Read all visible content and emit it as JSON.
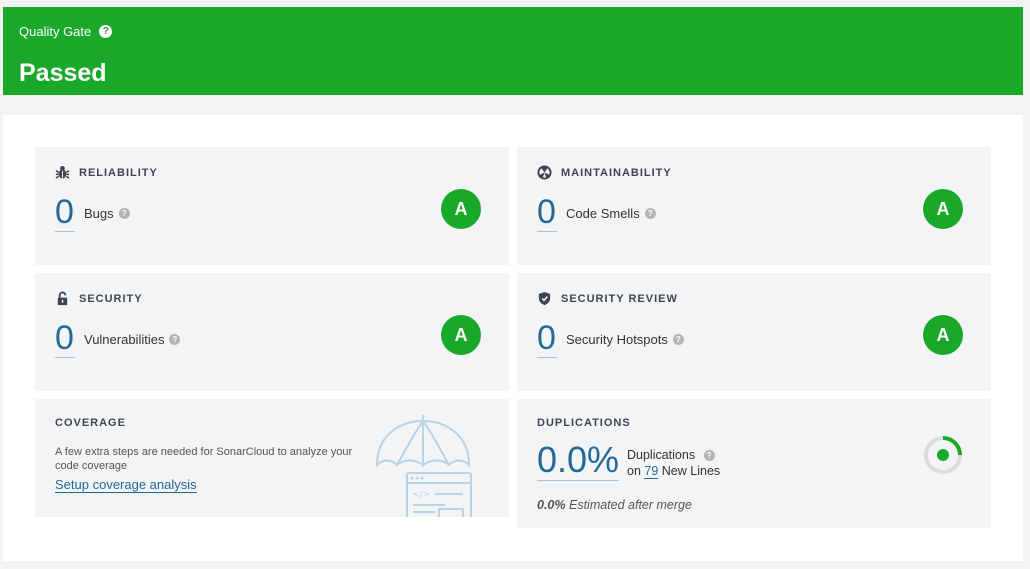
{
  "quality_gate": {
    "label": "Quality Gate",
    "help": "?",
    "status": "Passed",
    "color": "#1aa82b"
  },
  "cards": {
    "reliability": {
      "title": "RELIABILITY",
      "icon": "bug-icon",
      "value": "0",
      "label": "Bugs",
      "rating": "A"
    },
    "maintainability": {
      "title": "MAINTAINABILITY",
      "icon": "code-smell-icon",
      "value": "0",
      "label": "Code Smells",
      "rating": "A"
    },
    "security": {
      "title": "SECURITY",
      "icon": "lock-icon",
      "value": "0",
      "label": "Vulnerabilities",
      "rating": "A"
    },
    "security_review": {
      "title": "SECURITY REVIEW",
      "icon": "shield-icon",
      "value": "0",
      "label": "Security Hotspots",
      "rating": "A"
    },
    "coverage": {
      "title": "COVERAGE",
      "text": "A few extra steps are needed for SonarCloud to analyze your code coverage",
      "link": "Setup coverage analysis",
      "illustration": "umbrella-icon"
    },
    "duplications": {
      "title": "DUPLICATIONS",
      "value": "0.0%",
      "label": "Duplications",
      "on_prefix": "on",
      "new_lines_count": "79",
      "new_lines_label": "New Lines",
      "merge_value": "0.0%",
      "merge_label": "Estimated after merge",
      "donut_icon": "duplication-donut-icon"
    }
  },
  "colors": {
    "accent_green": "#1aa82b",
    "link_blue": "#236a97",
    "card_bg": "#f3f4f6"
  }
}
